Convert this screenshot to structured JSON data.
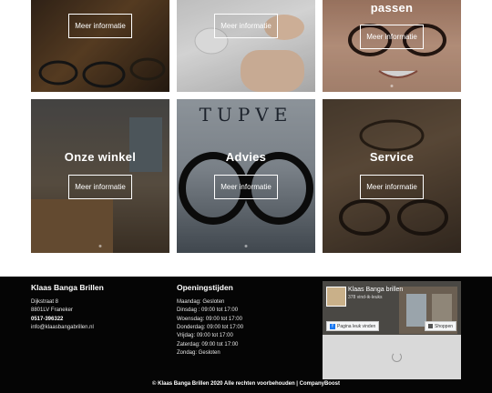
{
  "tiles": [
    {
      "title": "",
      "button_label": "Meer informatie"
    },
    {
      "title": "",
      "button_label": "Meer informatie"
    },
    {
      "title": "passen",
      "button_label": "Meer informatie"
    },
    {
      "title": "Onze winkel",
      "button_label": "Meer informatie"
    },
    {
      "title": "Advies",
      "button_label": "Meer informatie"
    },
    {
      "title": "Service",
      "button_label": "Meer informatie"
    }
  ],
  "footer": {
    "company": {
      "heading": "Klaas Banga Brillen",
      "address": "Dijkstraat 8",
      "city": "8801LV Franeker",
      "phone": "0517-396322",
      "email": "info@klaasbangabrillen.nl"
    },
    "hours": {
      "heading": "Openingstijden",
      "days": [
        "Maandag: Gesloten",
        "Dinsdag : 09:00 tot 17:00",
        "Woensdag: 09:00 tot 17:00",
        "Donderdag: 09:00 tot 17:00",
        "Vrijdag: 09:00 tot 17:00",
        "Zaterdag: 09:00 tot 17:00",
        "Zondag: Gesloten"
      ]
    },
    "facebook": {
      "page_name": "Klaas Banga brillen",
      "likes": "378 vind-ik-leuks",
      "like_button": "Pagina leuk vinden",
      "shop_button": "Shoppen"
    },
    "copyright": "© Klaas Banga Brillen 2020 Alle rechten voorbehouden | CompanyBoost"
  }
}
